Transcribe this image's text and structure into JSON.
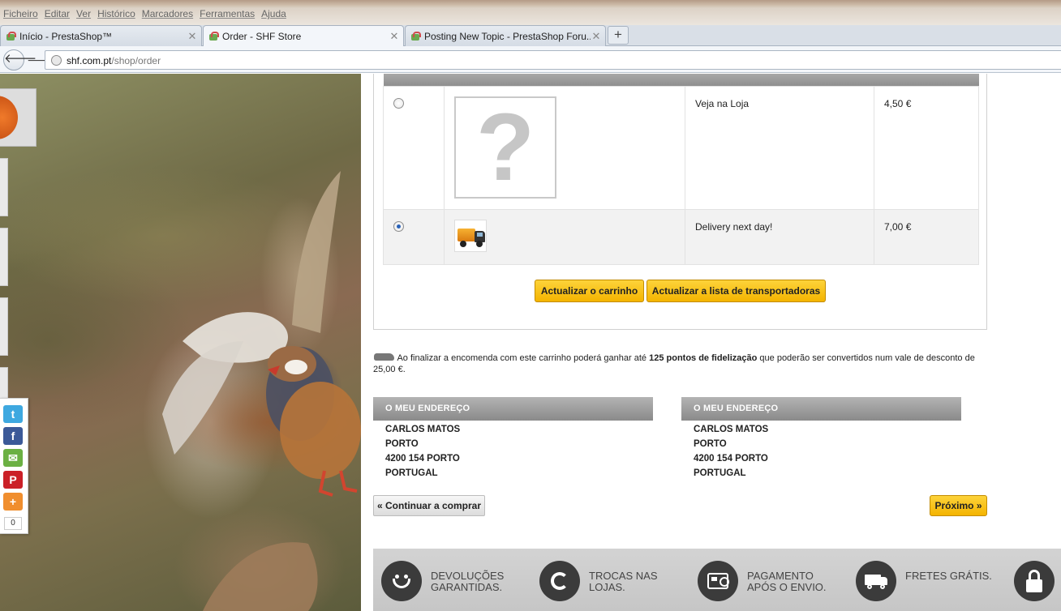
{
  "browser": {
    "menu": [
      "Ficheiro",
      "Editar",
      "Ver",
      "Histórico",
      "Marcadores",
      "Ferramentas",
      "Ajuda"
    ],
    "tabs": [
      {
        "title": "Início - PrestaShop™",
        "active": false
      },
      {
        "title": "Order - SHF Store",
        "active": true
      },
      {
        "title": "Posting New Topic - PrestaShop Foru...",
        "active": false
      }
    ],
    "new_tab_label": "+",
    "url_host": "shf.com.pt",
    "url_path": "/shop/order"
  },
  "social": {
    "share_count": "0",
    "buttons": [
      "twitter-icon",
      "facebook-icon",
      "email-icon",
      "pinterest-icon",
      "share-plus-icon"
    ]
  },
  "carriers": [
    {
      "name": "Veja na Loja",
      "price": "4,50 €",
      "selected": false,
      "logo": "question-mark-placeholder"
    },
    {
      "name": "Delivery next day!",
      "price": "7,00 €",
      "selected": true,
      "logo": "truck-icon"
    }
  ],
  "buttons": {
    "update_cart": "Actualizar o carrinho",
    "update_carriers": "Actualizar a lista de transportadoras",
    "continue_shopping": "« Continuar a comprar",
    "next": "Próximo »"
  },
  "loyalty": {
    "before": " Ao finalizar a encomenda com este carrinho poderá ganhar até ",
    "points": "125 pontos de fidelização",
    "after": " que poderão ser convertidos num vale de desconto de 25,00 €."
  },
  "addresses": [
    {
      "title": "O MEU ENDEREÇO",
      "name": "CARLOS MATOS",
      "city": "PORTO",
      "postal": "4200 154 PORTO",
      "country": "PORTUGAL"
    },
    {
      "title": "O MEU ENDEREÇO",
      "name": "CARLOS MATOS",
      "city": "PORTO",
      "postal": "4200 154 PORTO",
      "country": "PORTUGAL"
    }
  ],
  "reassurance": [
    {
      "line1": "DEVOLUÇÕES",
      "line2": "GARANTIDAS.",
      "icon": "smiley-icon"
    },
    {
      "line1": "TROCAS NAS",
      "line2": "LOJAS.",
      "icon": "refresh-icon"
    },
    {
      "line1": "PAGAMENTO",
      "line2": "APÓS O ENVIO.",
      "icon": "payment-card-icon"
    },
    {
      "line1": "FRETES GRÁTIS.",
      "line2": "",
      "icon": "van-icon"
    },
    {
      "line1": "",
      "line2": "",
      "icon": "lock-icon"
    }
  ],
  "colors": {
    "accent_yellow": "#f4b400",
    "header_grey": "#8f8f8f"
  }
}
